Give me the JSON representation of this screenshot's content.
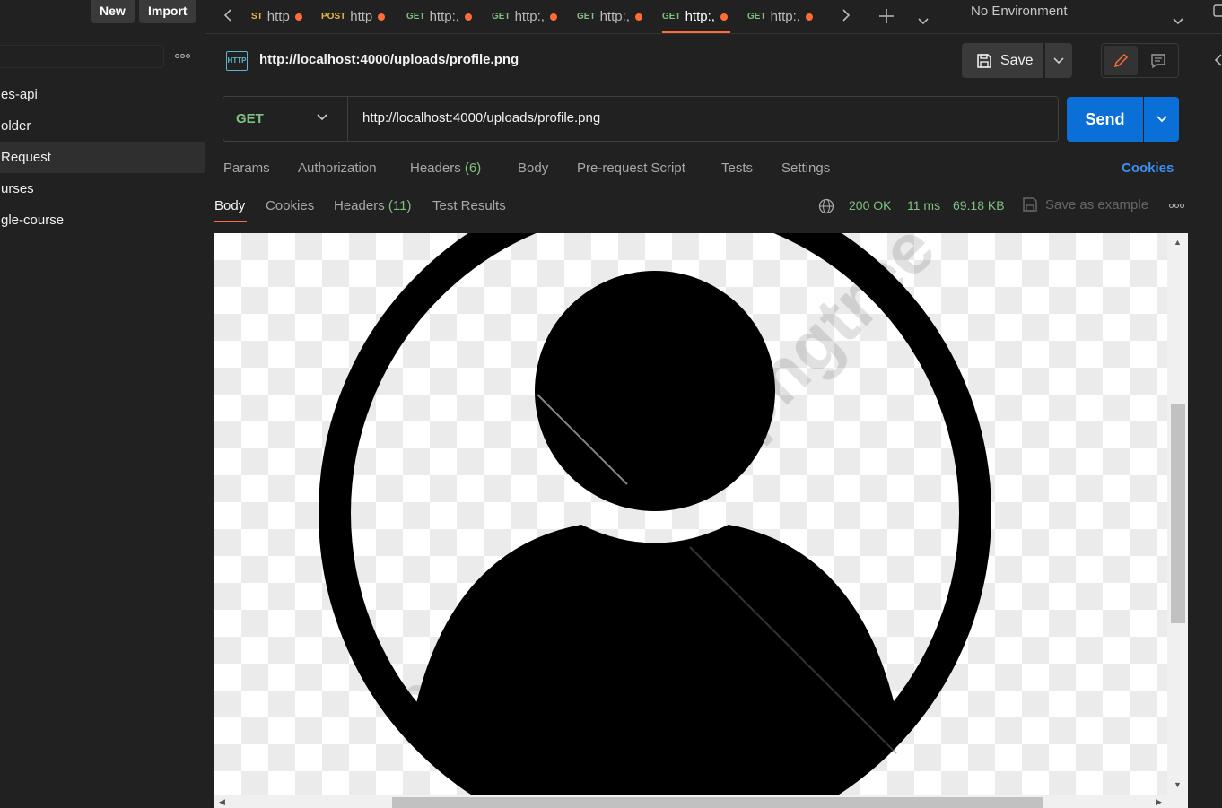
{
  "topbar": {
    "new_label": "New",
    "import_label": "Import"
  },
  "sidebar": {
    "items": [
      {
        "label": "es-api"
      },
      {
        "label": "older"
      },
      {
        "label": " Request"
      },
      {
        "label": "urses"
      },
      {
        "label": "gle-course"
      }
    ]
  },
  "tabs": [
    {
      "method": "ST",
      "label": "http"
    },
    {
      "method": "POST",
      "label": "http"
    },
    {
      "method": "GET",
      "label": "http:,"
    },
    {
      "method": "GET",
      "label": "http:,"
    },
    {
      "method": "GET",
      "label": "http:,"
    },
    {
      "method": "GET",
      "label": "http:,"
    },
    {
      "method": "GET",
      "label": "http:,"
    }
  ],
  "environment": {
    "label": "No Environment"
  },
  "request": {
    "title": "http://localhost:4000/uploads/profile.png",
    "icon_text": "HTTP",
    "method": "GET",
    "url": "http://localhost:4000/uploads/profile.png",
    "save_label": "Save",
    "send_label": "Send"
  },
  "request_tabs": {
    "params": "Params",
    "authorization": "Authorization",
    "headers": "Headers",
    "headers_count": "(6)",
    "body": "Body",
    "prerequest": "Pre-request Script",
    "tests": "Tests",
    "settings": "Settings",
    "cookies": "Cookies"
  },
  "response": {
    "tabs": {
      "body": "Body",
      "cookies": "Cookies",
      "headers": "Headers",
      "headers_count": "(11)",
      "test_results": "Test Results"
    },
    "status": "200 OK",
    "time": "11 ms",
    "size": "69.18 KB",
    "save_example": "Save as example"
  },
  "preview": {
    "icon": "user-profile-icon",
    "watermark": "pngtree"
  },
  "colors": {
    "accent": "#ff6c37",
    "send": "#0a6fd6",
    "success": "#7ec17e",
    "link": "#3d8ef0"
  }
}
